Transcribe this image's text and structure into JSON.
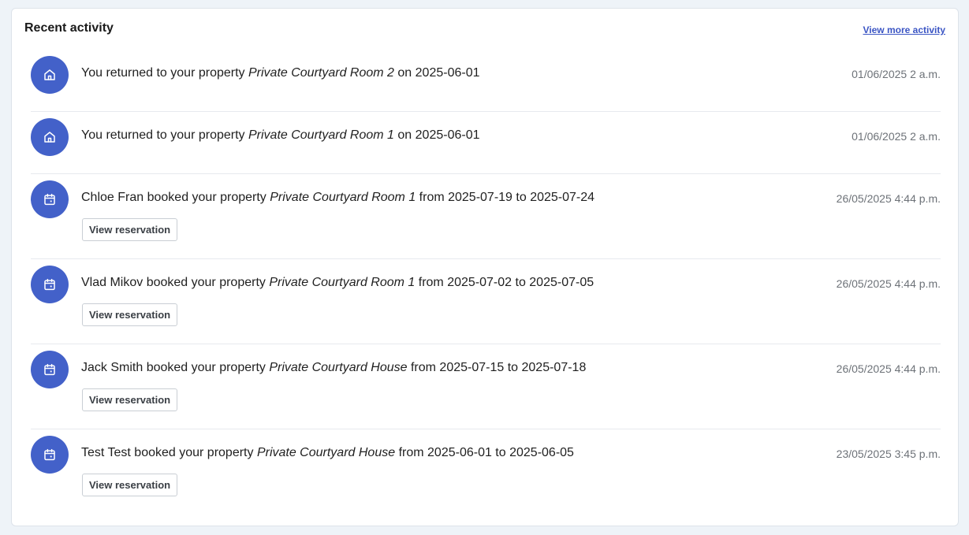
{
  "card": {
    "title": "Recent activity",
    "view_more_label": "View more activity"
  },
  "colors": {
    "accent": "#4361c9",
    "link": "#3b55c4"
  },
  "activities": [
    {
      "icon": "home-icon",
      "prefix": "You returned to your property ",
      "property": "Private Courtyard Room 2",
      "suffix": " on 2025-06-01",
      "timestamp": "01/06/2025 2 a.m."
    },
    {
      "icon": "home-icon",
      "prefix": "You returned to your property ",
      "property": "Private Courtyard Room 1",
      "suffix": " on 2025-06-01",
      "timestamp": "01/06/2025 2 a.m."
    },
    {
      "icon": "calendar-icon",
      "prefix": "Chloe Fran booked your property ",
      "property": "Private Courtyard Room 1",
      "suffix": " from 2025-07-19 to 2025-07-24",
      "timestamp": "26/05/2025 4:44 p.m.",
      "button_label": "View reservation"
    },
    {
      "icon": "calendar-icon",
      "prefix": "Vlad Mikov booked your property ",
      "property": "Private Courtyard Room 1",
      "suffix": " from 2025-07-02 to 2025-07-05",
      "timestamp": "26/05/2025 4:44 p.m.",
      "button_label": "View reservation"
    },
    {
      "icon": "calendar-icon",
      "prefix": "Jack Smith booked your property ",
      "property": "Private Courtyard House",
      "suffix": " from 2025-07-15 to 2025-07-18",
      "timestamp": "26/05/2025 4:44 p.m.",
      "button_label": "View reservation"
    },
    {
      "icon": "calendar-icon",
      "prefix": "Test Test booked your property ",
      "property": "Private Courtyard House",
      "suffix": " from 2025-06-01 to 2025-06-05",
      "timestamp": "23/05/2025 3:45 p.m.",
      "button_label": "View reservation"
    }
  ]
}
